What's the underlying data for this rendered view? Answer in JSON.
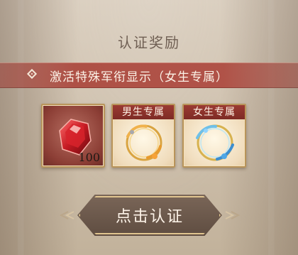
{
  "title": "认证奖励",
  "banner": {
    "text": "激活特殊军衔显示（女生专属）",
    "icon": "diamond-icon"
  },
  "rewards": [
    {
      "item": "red-gem",
      "quantity": "100"
    },
    {
      "label": "男生专属",
      "item": "gold-ring-frame"
    },
    {
      "label": "女生专属",
      "item": "blue-ring-frame"
    }
  ],
  "button": {
    "label": "点击认证"
  },
  "colors": {
    "banner": "#aa443a",
    "button": "#6b584b",
    "card_border": "#b9945a",
    "title": "#6f5f53"
  }
}
